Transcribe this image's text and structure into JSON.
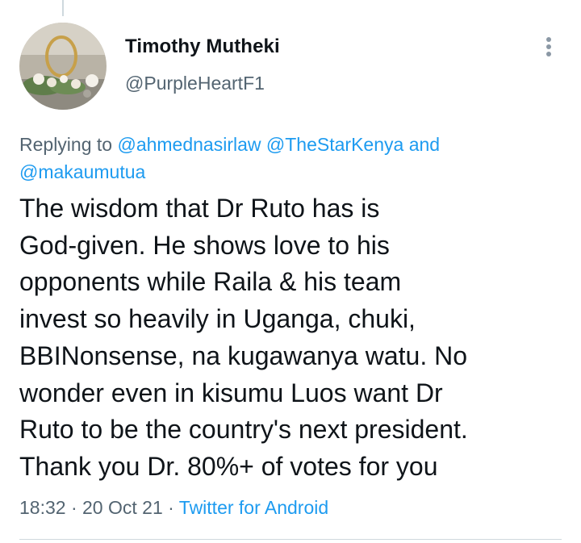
{
  "author": {
    "display_name": "Timothy Mutheki",
    "handle": "@PurpleHeartF1"
  },
  "reply": {
    "prefix": "Replying to",
    "handle_1": "@ahmednasirlaw",
    "handle_2": "@TheStarKenya",
    "conjunction": "and",
    "handle_3": "@makaumutua"
  },
  "tweet": {
    "text": "The wisdom that Dr Ruto has is\nGod-given. He shows love to his\nopponents while Raila & his team\ninvest so heavily in Uganga, chuki,\nBBINonsense, na kugawanya watu. No\nwonder even in kisumu Luos want Dr\nRuto to be the country's next president.\nThank you Dr. 80%+ of votes for you"
  },
  "meta": {
    "time": "18:32",
    "date": "20 Oct 21",
    "separator": "·",
    "source": "Twitter for Android"
  },
  "icons": {
    "more": "more-vertical-icon",
    "avatar": "avatar-photo"
  },
  "colors": {
    "accent": "#1d9bf0",
    "secondary_text": "#536471",
    "primary_text": "#0f1419"
  }
}
